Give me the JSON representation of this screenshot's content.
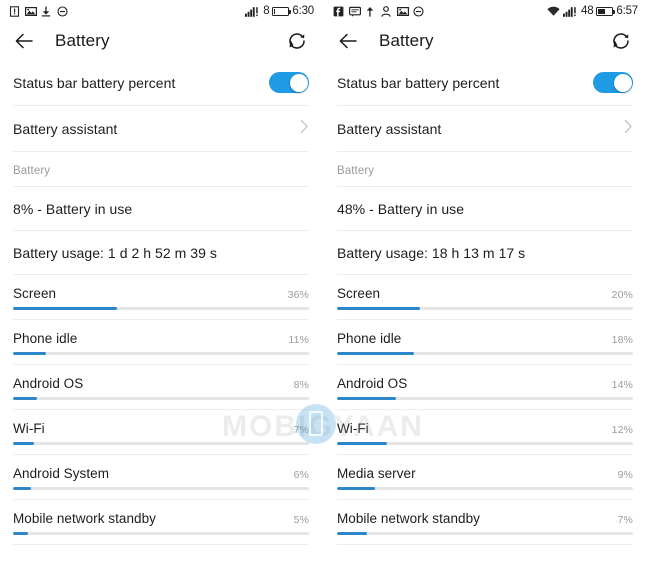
{
  "colors": {
    "accent": "#2d86c8",
    "toggle_on": "#1f9ae4",
    "track": "#e4e5e5",
    "divider": "#eceded",
    "label_muted": "#9b9b9b",
    "text": "#1d1d1d",
    "background": "#ffffff"
  },
  "watermark": {
    "text": "MOBIGYAAN",
    "logo_icon": "mobile-phone-logo-icon"
  },
  "screens": [
    {
      "status_bar": {
        "notification_icons": [
          "alert-box-icon",
          "image-icon",
          "download-icon",
          "minus-circle-icon"
        ],
        "signal_icon": "signal-bars-alert-icon",
        "battery_level_text": "8",
        "battery_fill_percent": 8,
        "battery_icon": "battery-icon",
        "time": "6:30"
      },
      "app_bar": {
        "back_icon": "back-arrow-icon",
        "title": "Battery",
        "refresh_icon": "refresh-icon"
      },
      "settings": [
        {
          "label": "Status bar battery percent",
          "control": "toggle",
          "toggle_on": true
        },
        {
          "label": "Battery assistant",
          "control": "chevron",
          "chevron_icon": "chevron-right-icon"
        }
      ],
      "section_label": "Battery",
      "status_rows": [
        {
          "label": "8% - Battery in use"
        },
        {
          "label": "Battery usage: 1 d 2 h 52 m 39 s"
        }
      ],
      "usage": [
        {
          "name": "Screen",
          "percent_text": "36%",
          "percent": 36,
          "bar_fill": 35
        },
        {
          "name": "Phone idle",
          "percent_text": "11%",
          "percent": 11,
          "bar_fill": 11
        },
        {
          "name": "Android OS",
          "percent_text": "8%",
          "percent": 8,
          "bar_fill": 8
        },
        {
          "name": "Wi-Fi",
          "percent_text": "7%",
          "percent": 7,
          "bar_fill": 7
        },
        {
          "name": "Android System",
          "percent_text": "6%",
          "percent": 6,
          "bar_fill": 6
        },
        {
          "name": "Mobile network standby",
          "percent_text": "5%",
          "percent": 5,
          "bar_fill": 5
        }
      ]
    },
    {
      "status_bar": {
        "notification_icons": [
          "facebook-icon",
          "message-icon",
          "upload-icon",
          "person-icon",
          "image-icon",
          "minus-circle-icon"
        ],
        "wifi_icon": "wifi-icon",
        "signal_icon": "signal-bars-alert-icon",
        "battery_level_text": "48",
        "battery_fill_percent": 48,
        "battery_icon": "battery-icon",
        "time": "6:57"
      },
      "app_bar": {
        "back_icon": "back-arrow-icon",
        "title": "Battery",
        "refresh_icon": "refresh-icon"
      },
      "settings": [
        {
          "label": "Status bar battery percent",
          "control": "toggle",
          "toggle_on": true
        },
        {
          "label": "Battery assistant",
          "control": "chevron",
          "chevron_icon": "chevron-right-icon"
        }
      ],
      "section_label": "Battery",
      "status_rows": [
        {
          "label": "48% - Battery in use"
        },
        {
          "label": "Battery usage: 18 h 13 m 17 s"
        }
      ],
      "usage": [
        {
          "name": "Screen",
          "percent_text": "20%",
          "percent": 20,
          "bar_fill": 28
        },
        {
          "name": "Phone idle",
          "percent_text": "18%",
          "percent": 18,
          "bar_fill": 26
        },
        {
          "name": "Android OS",
          "percent_text": "14%",
          "percent": 14,
          "bar_fill": 20
        },
        {
          "name": "Wi-Fi",
          "percent_text": "12%",
          "percent": 12,
          "bar_fill": 17
        },
        {
          "name": "Media server",
          "percent_text": "9%",
          "percent": 9,
          "bar_fill": 13
        },
        {
          "name": "Mobile network standby",
          "percent_text": "7%",
          "percent": 7,
          "bar_fill": 10
        }
      ]
    }
  ]
}
